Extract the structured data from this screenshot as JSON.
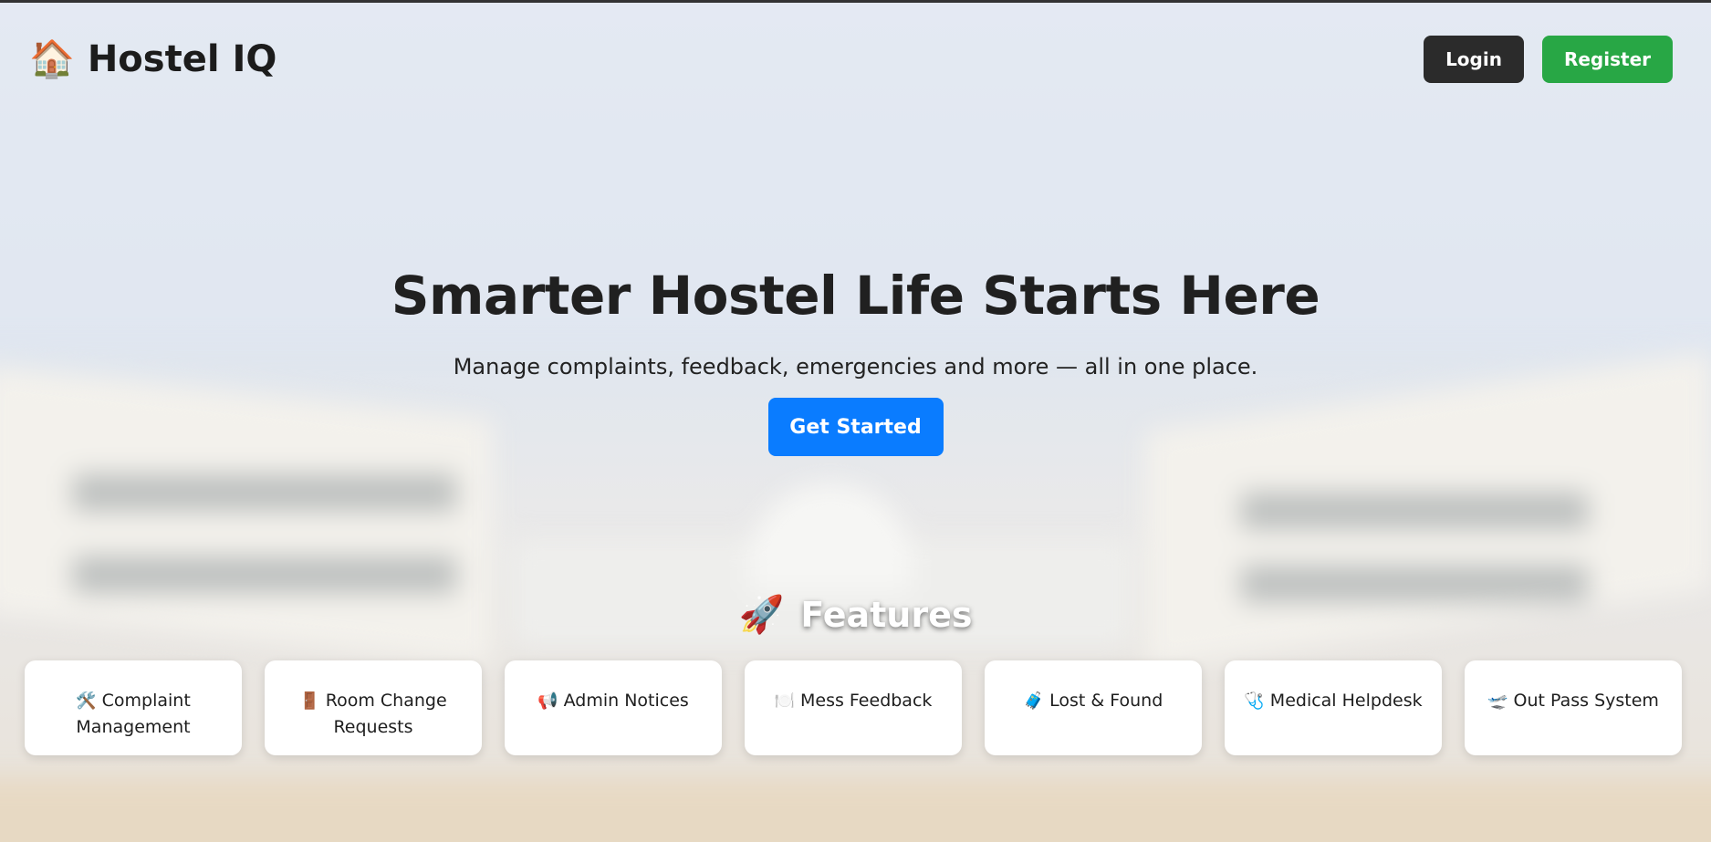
{
  "brand": {
    "icon": "house-icon",
    "icon_glyph": "🏠",
    "title": "Hostel IQ"
  },
  "auth": {
    "login_label": "Login",
    "register_label": "Register",
    "login_color": "#2b2b2b",
    "register_color": "#28a745"
  },
  "hero": {
    "heading": "Smarter Hostel Life Starts Here",
    "subtitle": "Manage complaints, feedback, emergencies and more — all in one place.",
    "cta_label": "Get Started",
    "cta_color": "#0a7cff"
  },
  "features": {
    "icon": "rocket-icon",
    "icon_glyph": "🚀",
    "heading": "Features",
    "items": [
      {
        "icon": "tools-icon",
        "glyph": "🛠️",
        "label": "Complaint Management"
      },
      {
        "icon": "door-icon",
        "glyph": "🚪",
        "label": "Room Change Requests"
      },
      {
        "icon": "megaphone-icon",
        "glyph": "📢",
        "label": "Admin Notices"
      },
      {
        "icon": "plate-icon",
        "glyph": "🍽️",
        "label": "Mess Feedback"
      },
      {
        "icon": "luggage-icon",
        "glyph": "🧳",
        "label": "Lost & Found"
      },
      {
        "icon": "stethoscope-icon",
        "glyph": "🩺",
        "label": "Medical Helpdesk"
      },
      {
        "icon": "airplane-departure-icon",
        "glyph": "🛫",
        "label": "Out Pass System"
      }
    ]
  }
}
